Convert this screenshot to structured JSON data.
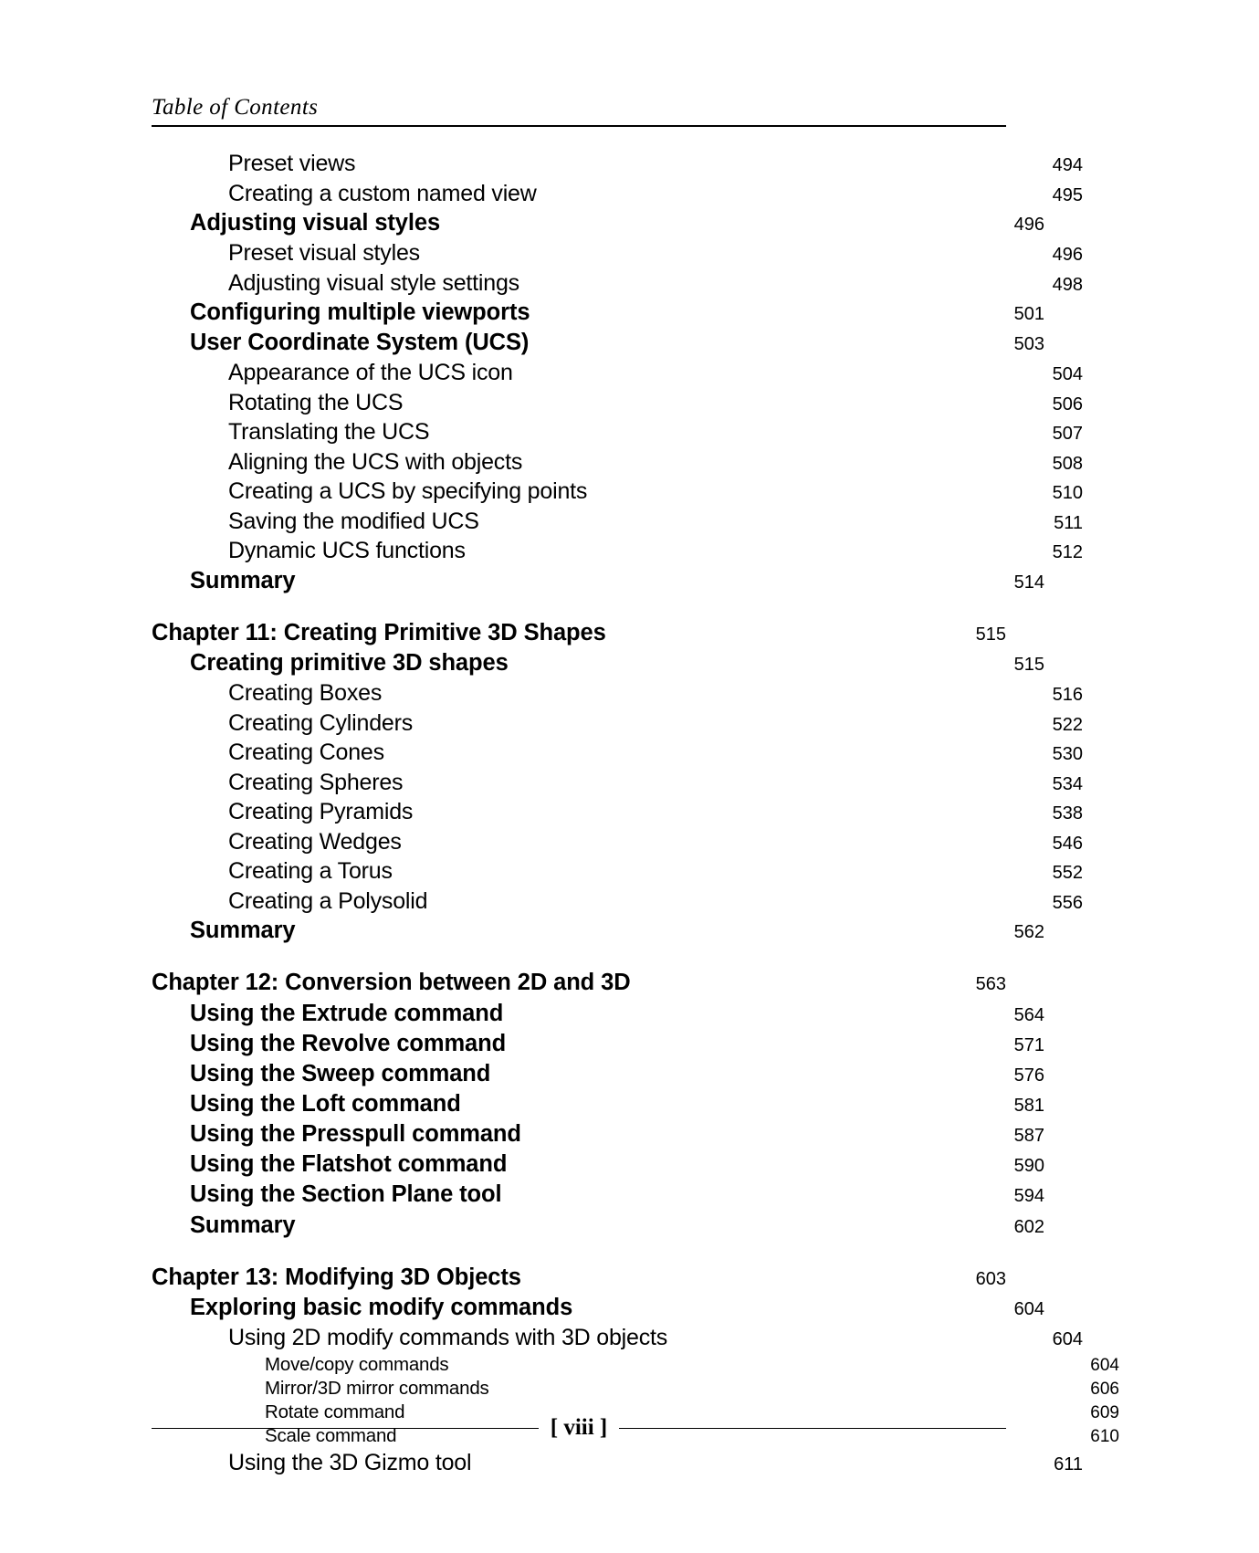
{
  "header": {
    "running_title": "Table of Contents"
  },
  "footer": {
    "page_label": "[ viii ]"
  },
  "toc": {
    "entries": [
      {
        "label": "Preset views",
        "page": "494",
        "level": 2,
        "gap_before": false
      },
      {
        "label": "Creating a custom named view",
        "page": "495",
        "level": 2,
        "gap_before": false
      },
      {
        "label": "Adjusting visual styles",
        "page": "496",
        "level": 1,
        "gap_before": false
      },
      {
        "label": "Preset visual styles",
        "page": "496",
        "level": 2,
        "gap_before": false
      },
      {
        "label": "Adjusting visual style settings",
        "page": "498",
        "level": 2,
        "gap_before": false
      },
      {
        "label": "Configuring multiple viewports",
        "page": "501",
        "level": 1,
        "gap_before": false
      },
      {
        "label": "User Coordinate System (UCS)",
        "page": "503",
        "level": 1,
        "gap_before": false
      },
      {
        "label": "Appearance of the UCS icon",
        "page": "504",
        "level": 2,
        "gap_before": false
      },
      {
        "label": "Rotating the UCS",
        "page": "506",
        "level": 2,
        "gap_before": false
      },
      {
        "label": "Translating the UCS",
        "page": "507",
        "level": 2,
        "gap_before": false
      },
      {
        "label": "Aligning the UCS with objects",
        "page": "508",
        "level": 2,
        "gap_before": false
      },
      {
        "label": "Creating a UCS by specifying points",
        "page": "510",
        "level": 2,
        "gap_before": false
      },
      {
        "label": "Saving the modified UCS",
        "page": "511",
        "level": 2,
        "gap_before": false
      },
      {
        "label": "Dynamic UCS functions",
        "page": "512",
        "level": 2,
        "gap_before": false
      },
      {
        "label": "Summary",
        "page": "514",
        "level": 1,
        "gap_before": false
      },
      {
        "label": "Chapter 11: Creating Primitive 3D Shapes",
        "page": "515",
        "level": 0,
        "gap_before": true
      },
      {
        "label": "Creating primitive 3D shapes",
        "page": "515",
        "level": 1,
        "gap_before": false
      },
      {
        "label": "Creating Boxes",
        "page": "516",
        "level": 2,
        "gap_before": false
      },
      {
        "label": "Creating Cylinders",
        "page": "522",
        "level": 2,
        "gap_before": false
      },
      {
        "label": "Creating Cones",
        "page": "530",
        "level": 2,
        "gap_before": false
      },
      {
        "label": "Creating Spheres",
        "page": "534",
        "level": 2,
        "gap_before": false
      },
      {
        "label": "Creating Pyramids",
        "page": "538",
        "level": 2,
        "gap_before": false
      },
      {
        "label": "Creating Wedges",
        "page": "546",
        "level": 2,
        "gap_before": false
      },
      {
        "label": "Creating a Torus",
        "page": "552",
        "level": 2,
        "gap_before": false
      },
      {
        "label": "Creating a Polysolid",
        "page": "556",
        "level": 2,
        "gap_before": false
      },
      {
        "label": "Summary",
        "page": "562",
        "level": 1,
        "gap_before": false
      },
      {
        "label": "Chapter 12: Conversion between 2D and 3D",
        "page": "563",
        "level": 0,
        "gap_before": true
      },
      {
        "label": "Using the Extrude command",
        "page": "564",
        "level": 1,
        "gap_before": false
      },
      {
        "label": "Using the Revolve command",
        "page": "571",
        "level": 1,
        "gap_before": false
      },
      {
        "label": "Using the Sweep command",
        "page": "576",
        "level": 1,
        "gap_before": false
      },
      {
        "label": "Using the Loft command",
        "page": "581",
        "level": 1,
        "gap_before": false
      },
      {
        "label": "Using the Presspull command",
        "page": "587",
        "level": 1,
        "gap_before": false
      },
      {
        "label": "Using the Flatshot command",
        "page": "590",
        "level": 1,
        "gap_before": false
      },
      {
        "label": "Using the Section Plane tool",
        "page": "594",
        "level": 1,
        "gap_before": false
      },
      {
        "label": "Summary",
        "page": "602",
        "level": 1,
        "gap_before": false
      },
      {
        "label": "Chapter 13: Modifying 3D Objects",
        "page": "603",
        "level": 0,
        "gap_before": true
      },
      {
        "label": "Exploring basic modify commands",
        "page": "604",
        "level": 1,
        "gap_before": false
      },
      {
        "label": "Using 2D modify commands with 3D objects",
        "page": "604",
        "level": 2,
        "gap_before": false
      },
      {
        "label": "Move/copy commands",
        "page": "604",
        "level": 3,
        "gap_before": false
      },
      {
        "label": "Mirror/3D mirror commands",
        "page": "606",
        "level": 3,
        "gap_before": false
      },
      {
        "label": "Rotate command",
        "page": "609",
        "level": 3,
        "gap_before": false
      },
      {
        "label": "Scale command",
        "page": "610",
        "level": 3,
        "gap_before": false
      },
      {
        "label": "Using the 3D Gizmo tool",
        "page": "611",
        "level": 2,
        "gap_before": false
      }
    ]
  }
}
